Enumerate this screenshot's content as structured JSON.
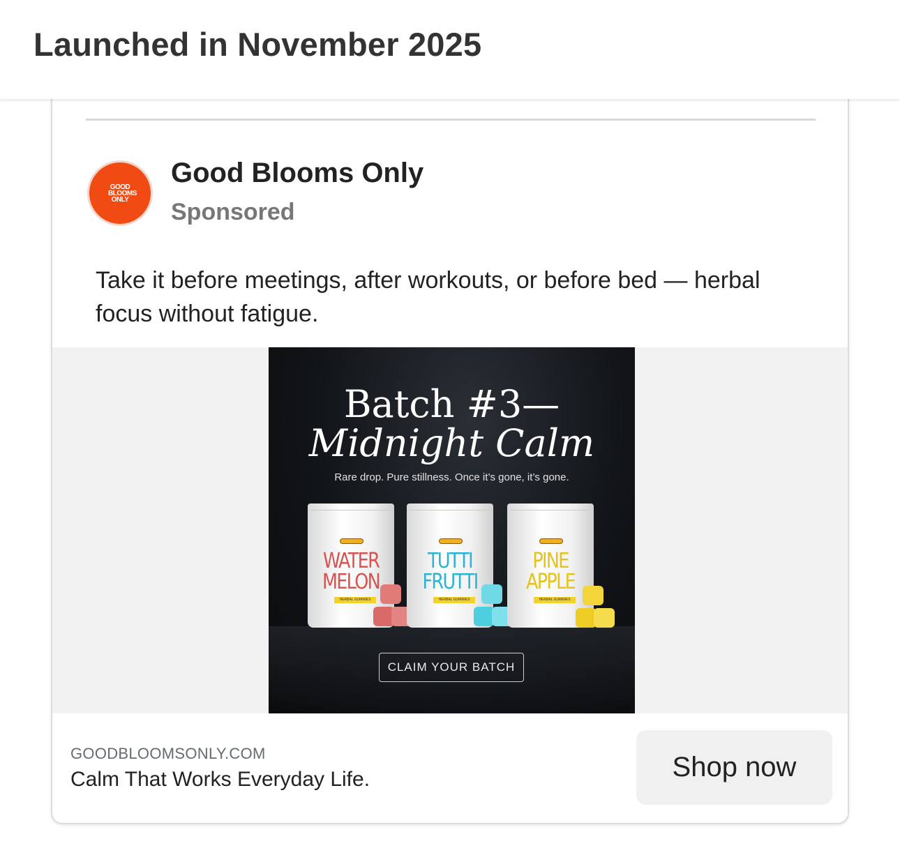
{
  "header": {
    "title": "Launched in November 2025"
  },
  "ad": {
    "brand_name": "Good Blooms Only",
    "sponsored_label": "Sponsored",
    "avatar_logo_text": "GOOD BLOOMS ONLY",
    "avatar_color": "#f14a12",
    "caption": "Take it before meetings, after workouts, or before bed — herbal focus without fatigue.",
    "creative": {
      "headline_line1": "Batch #3—",
      "headline_line2": "Midnight Calm",
      "subline": "Rare drop. Pure stillness. Once it’s gone, it’s gone.",
      "products": [
        {
          "flavor_line1": "WATER",
          "flavor_line2": "MELON",
          "label": "HERBAL GUMMIES",
          "color": "#d9534f"
        },
        {
          "flavor_line1": "TUTTI",
          "flavor_line2": "FRUTTI",
          "label": "HERBAL GUMMIES",
          "color": "#2bb3d6"
        },
        {
          "flavor_line1": "PINE",
          "flavor_line2": "APPLE",
          "label": "HERBAL GUMMIES",
          "color": "#e6c21a"
        }
      ],
      "cta_label": "CLAIM YOUR BATCH"
    },
    "footer": {
      "domain": "GOODBLOOMSONLY.COM",
      "headline": "Calm That Works Everyday Life.",
      "button_label": "Shop now"
    }
  }
}
